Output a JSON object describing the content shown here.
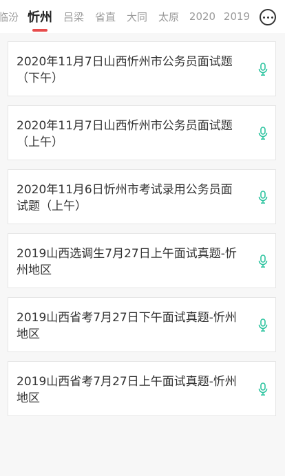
{
  "tabs": [
    {
      "label": "临汾",
      "active": false
    },
    {
      "label": "忻州",
      "active": true
    },
    {
      "label": "吕梁",
      "active": false
    },
    {
      "label": "省直",
      "active": false
    },
    {
      "label": "大同",
      "active": false
    },
    {
      "label": "太原",
      "active": false
    },
    {
      "label": "2020",
      "active": false
    },
    {
      "label": "2019",
      "active": false
    }
  ],
  "more_icon": "more-horizontal-circle-icon",
  "accent_color": "#e74c4c",
  "mic_color": "#2ec4a0",
  "items": [
    {
      "title": "2020年11月7日山西忻州市公务员面试题（下午）",
      "icon": "microphone-icon"
    },
    {
      "title": "2020年11月7日山西忻州市公务员面试题（上午）",
      "icon": "microphone-icon"
    },
    {
      "title": "2020年11月6日忻州市考试录用公务员面试题（上午）",
      "icon": "microphone-icon"
    },
    {
      "title": "2019山西选调生7月27日上午面试真题-忻州地区",
      "icon": "microphone-icon"
    },
    {
      "title": "2019山西省考7月27日下午面试真题-忻州地区",
      "icon": "microphone-icon"
    },
    {
      "title": "2019山西省考7月27日上午面试真题-忻州地区",
      "icon": "microphone-icon"
    }
  ]
}
